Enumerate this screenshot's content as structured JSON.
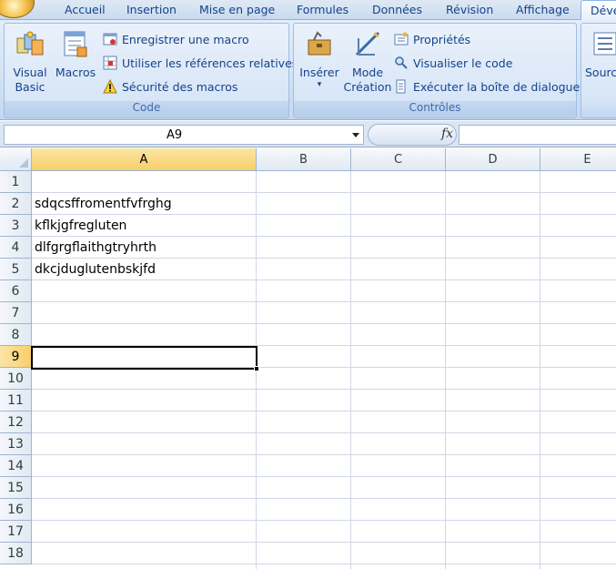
{
  "ribbon": {
    "tabs": [
      "Accueil",
      "Insertion",
      "Mise en page",
      "Formules",
      "Données",
      "Révision",
      "Affichage",
      "Déve"
    ],
    "active_tab": "Déve",
    "code_group": {
      "label": "Code",
      "visual_basic": "Visual Basic",
      "visual_basic_line1": "Visual",
      "visual_basic_line2": "Basic",
      "macros": "Macros",
      "record_macro": "Enregistrer une macro",
      "relative_refs": "Utiliser les références relatives",
      "macro_security": "Sécurité des macros"
    },
    "controls_group": {
      "label": "Contrôles",
      "insert": "Insérer",
      "design_mode_line1": "Mode",
      "design_mode_line2": "Création",
      "properties": "Propriétés",
      "view_code": "Visualiser le code",
      "run_dialog": "Exécuter la boîte de dialogue"
    },
    "partial_group": {
      "label_fragment": "Sourc"
    }
  },
  "formula_bar": {
    "name_box": "A9",
    "fx_label": "fx",
    "formula": ""
  },
  "sheet": {
    "columns": [
      "A",
      "B",
      "C",
      "D",
      "E"
    ],
    "selected_column": "A",
    "rows": [
      "1",
      "2",
      "3",
      "4",
      "5",
      "6",
      "7",
      "8",
      "9",
      "10",
      "11",
      "12",
      "13",
      "14",
      "15",
      "16",
      "17",
      "18"
    ],
    "selected_row": "9",
    "cells": {
      "A2": "sdqcsffromentfvfrghg",
      "A3": "kflkjgfregluten",
      "A4": "dlfgrgflaithgtryhrth",
      "A5": "dkcjduglutenbskjfd"
    }
  },
  "colors": {
    "ribbon_text": "#15428b",
    "selection_header": "#f8cf6b",
    "gridline": "#d0d7e5"
  }
}
